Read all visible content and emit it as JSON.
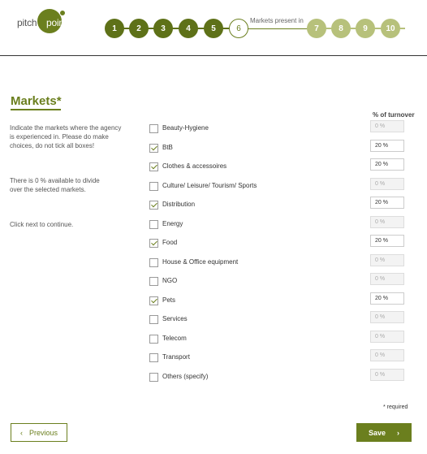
{
  "logo": {
    "part1": "pitch",
    "part2": "point"
  },
  "stepper": {
    "steps": [
      {
        "label": "1",
        "state": "done"
      },
      {
        "label": "2",
        "state": "done"
      },
      {
        "label": "3",
        "state": "done"
      },
      {
        "label": "4",
        "state": "done"
      },
      {
        "label": "5",
        "state": "done"
      },
      {
        "label": "6",
        "state": "current"
      },
      {
        "label": "7",
        "state": "todo"
      },
      {
        "label": "8",
        "state": "todo"
      },
      {
        "label": "9",
        "state": "todo"
      },
      {
        "label": "10",
        "state": "todo"
      }
    ],
    "current_label": "Markets present in"
  },
  "page": {
    "title": "Markets*",
    "instructions": "Indicate the markets where the agency is experienced in. Please do make choices, do not tick all boxes!",
    "available_note": "There is 0 % available to divide over the selected markets.",
    "continue_note": "Click next to continue.",
    "turnover_header": "% of turnover",
    "required_note": "* required"
  },
  "markets": [
    {
      "label": "Beauty-Hygiene",
      "checked": false,
      "value": "0 %"
    },
    {
      "label": "BtB",
      "checked": true,
      "value": "20 %"
    },
    {
      "label": "Clothes & accessoires",
      "checked": true,
      "value": "20 %"
    },
    {
      "label": "Culture/ Leisure/ Tourism/ Sports",
      "checked": false,
      "value": "0 %"
    },
    {
      "label": "Distribution",
      "checked": true,
      "value": "20 %"
    },
    {
      "label": "Energy",
      "checked": false,
      "value": "0 %"
    },
    {
      "label": "Food",
      "checked": true,
      "value": "20 %"
    },
    {
      "label": "House & Office equipment",
      "checked": false,
      "value": "0 %"
    },
    {
      "label": "NGO",
      "checked": false,
      "value": "0 %"
    },
    {
      "label": "Pets",
      "checked": true,
      "value": "20 %"
    },
    {
      "label": "Services",
      "checked": false,
      "value": "0 %"
    },
    {
      "label": "Telecom",
      "checked": false,
      "value": "0 %"
    },
    {
      "label": "Transport",
      "checked": false,
      "value": "0 %"
    },
    {
      "label": "Others (specify)",
      "checked": false,
      "value": "0 %"
    }
  ],
  "buttons": {
    "previous_label": "Previous",
    "previous_icon": "chevron-left-icon",
    "save_label": "Save",
    "save_icon": "chevron-right-icon"
  },
  "colors": {
    "accent": "#6b7f1e",
    "step_done": "#5e7118",
    "step_todo": "#b7c17b"
  }
}
